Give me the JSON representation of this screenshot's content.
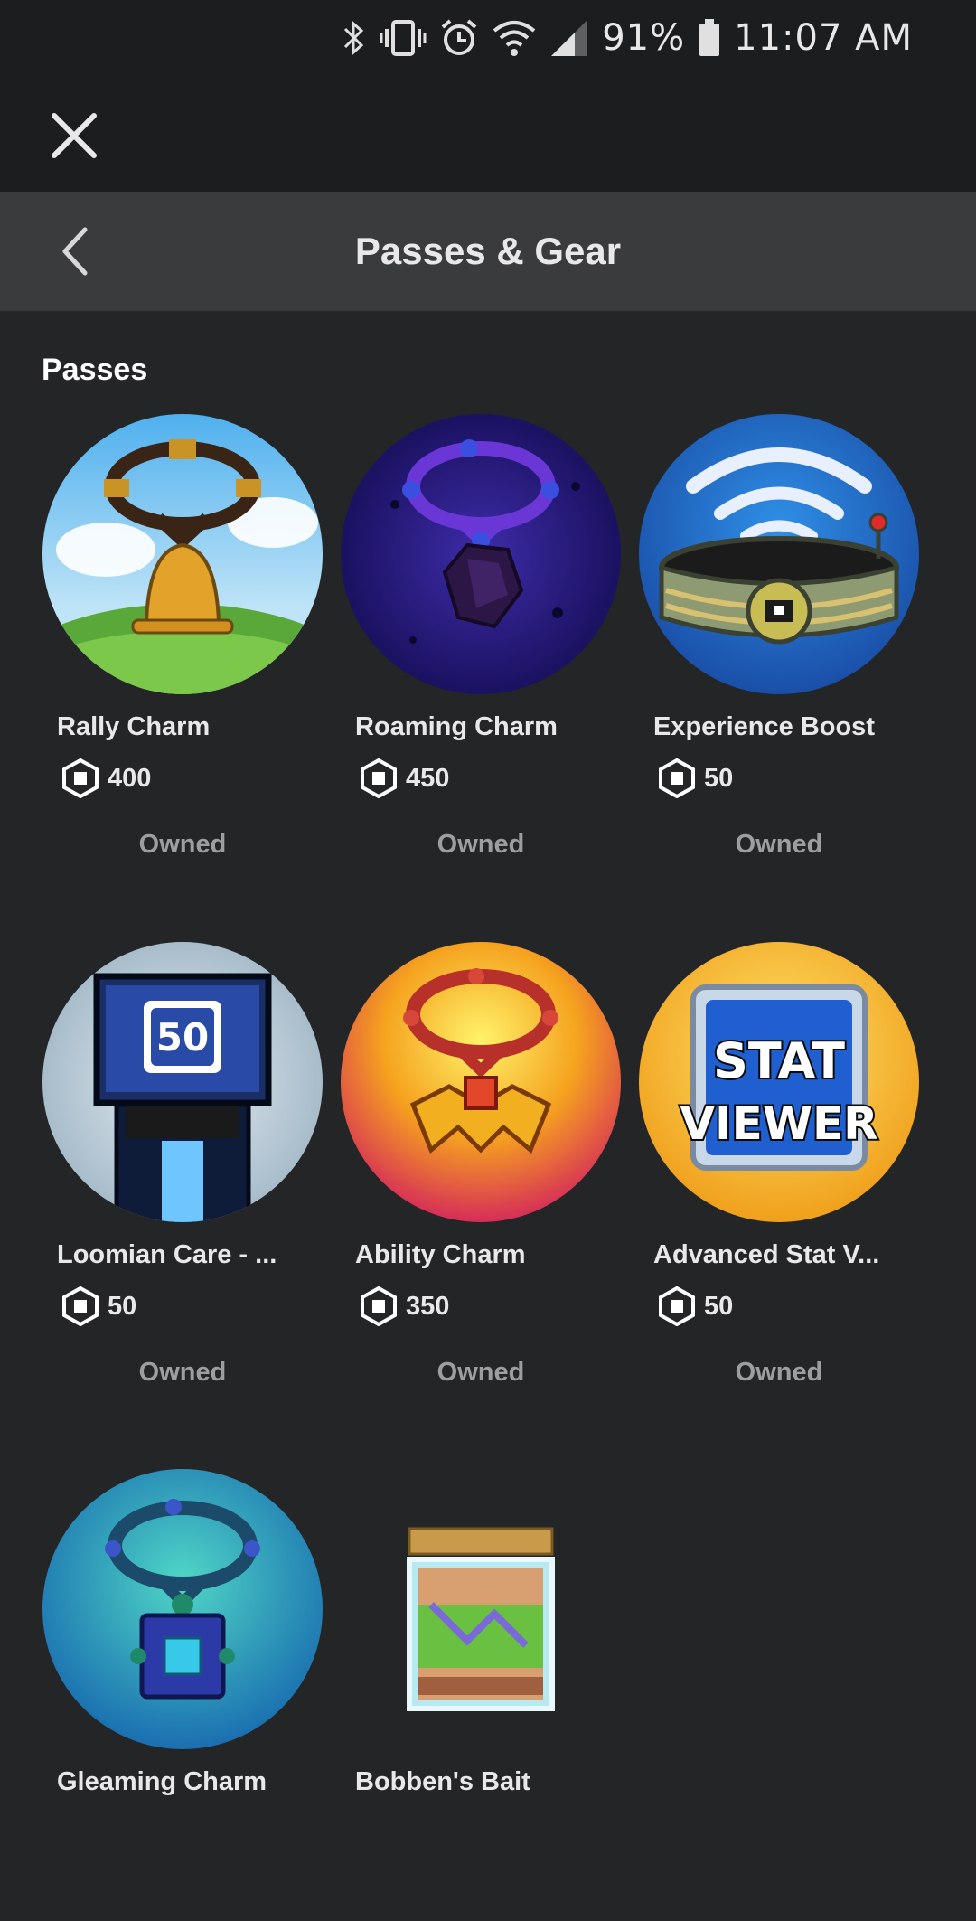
{
  "status_bar": {
    "battery": "91%",
    "time": "11:07 AM",
    "icons": [
      "bluetooth-icon",
      "vibrate-icon",
      "alarm-icon",
      "wifi-icon",
      "signal-icon",
      "battery-icon"
    ]
  },
  "topbar": {
    "close_icon": "close-icon"
  },
  "header": {
    "back_icon": "chevron-left-icon",
    "title": "Passes & Gear"
  },
  "section": {
    "title": "Passes"
  },
  "currency_icon": "robux-icon",
  "items": [
    {
      "name": "Rally Charm",
      "price": "400",
      "status": "Owned",
      "icon": "bell-charm-icon"
    },
    {
      "name": "Roaming Charm",
      "price": "450",
      "status": "Owned",
      "icon": "purple-gem-charm-icon"
    },
    {
      "name": "Experience Boost",
      "price": "50",
      "status": "Owned",
      "icon": "exp-belt-icon"
    },
    {
      "name": "Loomian Care - ...",
      "price": "50",
      "status": "Owned",
      "icon": "care-machine-icon"
    },
    {
      "name": "Ability Charm",
      "price": "350",
      "status": "Owned",
      "icon": "ability-charm-icon"
    },
    {
      "name": "Advanced Stat V...",
      "price": "50",
      "status": "Owned",
      "icon": "stat-viewer-icon"
    },
    {
      "name": "Gleaming Charm",
      "icon": "gleaming-charm-icon"
    },
    {
      "name": "Bobben's Bait",
      "icon": "bait-jar-icon"
    }
  ],
  "stat_viewer_art_text": [
    "STAT",
    "VIEWER"
  ],
  "care_art_text": "50"
}
